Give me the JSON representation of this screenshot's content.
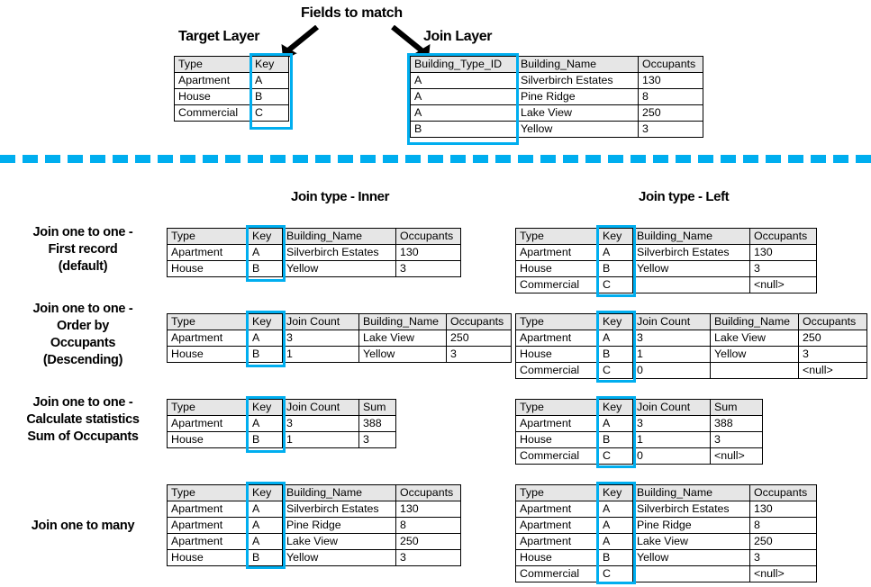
{
  "diagram": {
    "title_fields_to_match": "Fields to match",
    "accent_color": "#00aeef",
    "header_fill": "#e6e6e6",
    "border_color": "#000000"
  },
  "top": {
    "target_layer_label": "Target Layer",
    "join_layer_label": "Join Layer",
    "target_table": {
      "headers": [
        "Type",
        "Key"
      ],
      "rows": [
        [
          "Apartment",
          "A"
        ],
        [
          "House",
          "B"
        ],
        [
          "Commercial",
          "C"
        ]
      ]
    },
    "join_table": {
      "headers": [
        "Building_Type_ID",
        "Building_Name",
        "Occupants"
      ],
      "rows": [
        [
          "A",
          "Silverbirch Estates",
          "130"
        ],
        [
          "A",
          "Pine Ridge",
          "8"
        ],
        [
          "A",
          "Lake View",
          "250"
        ],
        [
          "B",
          "Yellow",
          "3"
        ]
      ]
    }
  },
  "columns": {
    "inner_label": "Join type - Inner",
    "left_label": "Join type - Left"
  },
  "rows": [
    {
      "label": "Join one to one -\nFirst record\n(default)",
      "inner": {
        "headers": [
          "Type",
          "Key",
          "Building_Name",
          "Occupants"
        ],
        "rows": [
          [
            "Apartment",
            "A",
            "Silverbirch Estates",
            "130"
          ],
          [
            "House",
            "B",
            "Yellow",
            "3"
          ]
        ]
      },
      "left": {
        "headers": [
          "Type",
          "Key",
          "Building_Name",
          "Occupants"
        ],
        "rows": [
          [
            "Apartment",
            "A",
            "Silverbirch Estates",
            "130"
          ],
          [
            "House",
            "B",
            "Yellow",
            "3"
          ],
          [
            "Commercial",
            "C",
            "",
            "<null>"
          ]
        ]
      }
    },
    {
      "label": "Join one to one -\nOrder by\nOccupants\n(Descending)",
      "inner": {
        "headers": [
          "Type",
          "Key",
          "Join Count",
          "Building_Name",
          "Occupants"
        ],
        "rows": [
          [
            "Apartment",
            "A",
            "3",
            "Lake View",
            "250"
          ],
          [
            "House",
            "B",
            "1",
            "Yellow",
            "3"
          ]
        ]
      },
      "left": {
        "headers": [
          "Type",
          "Key",
          "Join Count",
          "Building_Name",
          "Occupants"
        ],
        "rows": [
          [
            "Apartment",
            "A",
            "3",
            "Lake View",
            "250"
          ],
          [
            "House",
            "B",
            "1",
            "Yellow",
            "3"
          ],
          [
            "Commercial",
            "C",
            "0",
            "",
            "<null>"
          ]
        ]
      }
    },
    {
      "label": "Join one to one -\nCalculate statistics\nSum of Occupants",
      "inner": {
        "headers": [
          "Type",
          "Key",
          "Join Count",
          "Sum"
        ],
        "rows": [
          [
            "Apartment",
            "A",
            "3",
            "388"
          ],
          [
            "House",
            "B",
            "1",
            "3"
          ]
        ]
      },
      "left": {
        "headers": [
          "Type",
          "Key",
          "Join Count",
          "Sum"
        ],
        "rows": [
          [
            "Apartment",
            "A",
            "3",
            "388"
          ],
          [
            "House",
            "B",
            "1",
            "3"
          ],
          [
            "Commercial",
            "C",
            "0",
            "<null>"
          ]
        ]
      }
    },
    {
      "label": "Join one to many",
      "inner": {
        "headers": [
          "Type",
          "Key",
          "Building_Name",
          "Occupants"
        ],
        "rows": [
          [
            "Apartment",
            "A",
            "Silverbirch Estates",
            "130"
          ],
          [
            "Apartment",
            "A",
            "Pine Ridge",
            "8"
          ],
          [
            "Apartment",
            "A",
            "Lake View",
            "250"
          ],
          [
            "House",
            "B",
            "Yellow",
            "3"
          ]
        ]
      },
      "left": {
        "headers": [
          "Type",
          "Key",
          "Building_Name",
          "Occupants"
        ],
        "rows": [
          [
            "Apartment",
            "A",
            "Silverbirch Estates",
            "130"
          ],
          [
            "Apartment",
            "A",
            "Pine Ridge",
            "8"
          ],
          [
            "Apartment",
            "A",
            "Lake View",
            "250"
          ],
          [
            "House",
            "B",
            "Yellow",
            "3"
          ],
          [
            "Commercial",
            "C",
            "",
            "<null>"
          ]
        ]
      }
    }
  ]
}
